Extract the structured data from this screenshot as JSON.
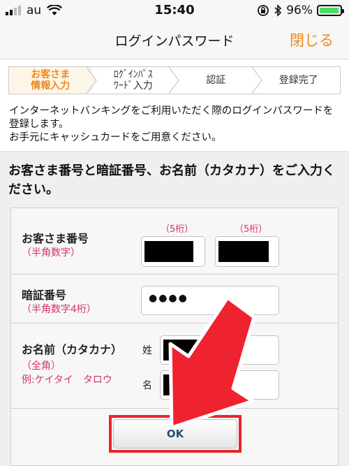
{
  "status_bar": {
    "carrier": "au",
    "time": "15:40",
    "battery_percent": "96%",
    "battery_level": 0.96,
    "icons": [
      "wifi-icon",
      "rotation-lock-icon",
      "bluetooth-icon",
      "battery-icon"
    ]
  },
  "nav": {
    "title": "ログインパスワード",
    "close_label": "閉じる"
  },
  "steps": [
    {
      "line1": "お客さま",
      "line2": "情報入力",
      "active": true
    },
    {
      "line1": "ﾛｸﾞｲﾝﾊﾟｽ",
      "line2": "ﾜｰﾄﾞ入力",
      "active": false
    },
    {
      "line1": "認証",
      "line2": "",
      "active": false
    },
    {
      "line1": "登録完了",
      "line2": "",
      "active": false
    }
  ],
  "description": {
    "line1": "インターネットバンキングをご利用いただく際のログインパスワードを登録します。",
    "line2": "お手元にキャッシュカードをご用意ください。"
  },
  "heading": "お客さま番号と暗証番号、お名前（カタカナ）をご入力ください。",
  "form": {
    "customer_number": {
      "label": "お客さま番号",
      "sub": "（半角数字）",
      "digits_1": "（5桁）",
      "digits_2": "（5桁）"
    },
    "pin": {
      "label": "暗証番号",
      "sub": "（半角数字4桁）",
      "value": "●●●●"
    },
    "name": {
      "label": "お名前（カタカナ）",
      "sub": "（全角）",
      "example": "例:ケイタイ　タロウ",
      "sei_label": "姓",
      "mei_label": "名"
    },
    "ok_label": "OK"
  },
  "colors": {
    "accent": "#f08a1d",
    "note": "#d2336d",
    "highlight": "#e6262c",
    "button_text": "#2a4b70"
  }
}
